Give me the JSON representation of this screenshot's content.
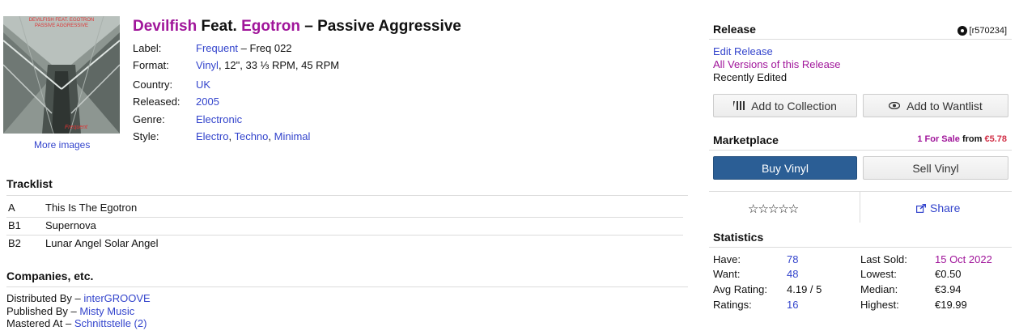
{
  "cover": {
    "top_text": "DEVILFISH FEAT. EGOTRON\nPASSIVE AGGRESSIVE",
    "bottom_text": "Frequent",
    "more_images": "More images"
  },
  "title": {
    "artist1": "Devilfish",
    "feat": " Feat. ",
    "artist2": "Egotron",
    "sep": " – ",
    "name": "Passive Aggressive"
  },
  "info": {
    "label": {
      "k": "Label:",
      "link": "Frequent",
      "rest": " – Freq 022"
    },
    "format": {
      "k": "Format:",
      "link": "Vinyl",
      "rest": ", 12\", 33 ⅓ RPM, 45 RPM"
    },
    "country": {
      "k": "Country:",
      "v": "UK"
    },
    "released": {
      "k": "Released:",
      "v": "2005"
    },
    "genre": {
      "k": "Genre:",
      "v": "Electronic"
    },
    "style": {
      "k": "Style:",
      "v1": "Electro",
      "v2": "Techno",
      "v3": "Minimal"
    }
  },
  "tracklist": {
    "heading": "Tracklist",
    "tracks": [
      {
        "pos": "A",
        "title": "This Is The Egotron"
      },
      {
        "pos": "B1",
        "title": "Supernova"
      },
      {
        "pos": "B2",
        "title": "Lunar Angel Solar Angel"
      }
    ]
  },
  "companies": {
    "heading": "Companies, etc.",
    "rows": [
      {
        "role": "Distributed By – ",
        "name": "interGROOVE"
      },
      {
        "role": "Published By – ",
        "name": "Misty Music"
      },
      {
        "role": "Mastered At – ",
        "name": "Schnittstelle (2)"
      }
    ]
  },
  "release": {
    "heading": "Release",
    "id": "[r570234]",
    "edit": "Edit Release",
    "all_versions": "All Versions of this Release",
    "recently_edited": "Recently Edited",
    "add_collection": "Add to Collection",
    "add_wantlist": "Add to Wantlist"
  },
  "marketplace": {
    "heading": "Marketplace",
    "for_sale": "1 For Sale",
    "from": " from ",
    "price": "€5.78",
    "buy": "Buy Vinyl",
    "sell": "Sell Vinyl",
    "stars": "☆☆☆☆☆",
    "share": "Share",
    "accent": "#2b5e95"
  },
  "statistics": {
    "heading": "Statistics",
    "have": {
      "k": "Have:",
      "v": "78"
    },
    "want": {
      "k": "Want:",
      "v": "48"
    },
    "avg": {
      "k": "Avg Rating:",
      "v": "4.19 / 5"
    },
    "ratings": {
      "k": "Ratings:",
      "v": "16"
    },
    "last_sold": {
      "k": "Last Sold:",
      "v": "15 Oct 2022"
    },
    "lowest": {
      "k": "Lowest:",
      "v": "€0.50"
    },
    "median": {
      "k": "Median:",
      "v": "€3.94"
    },
    "highest": {
      "k": "Highest:",
      "v": "€19.99"
    }
  }
}
